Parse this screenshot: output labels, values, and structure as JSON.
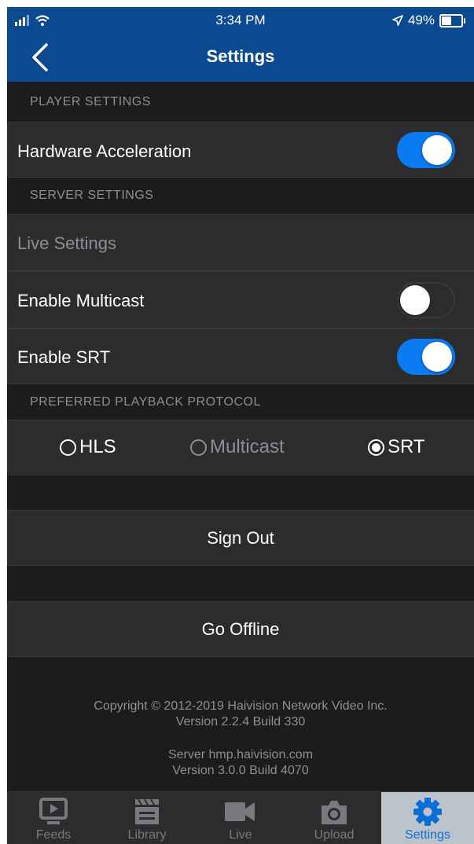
{
  "status_bar": {
    "time": "3:34 PM",
    "battery": "49%",
    "battery_level": 0.49
  },
  "header": {
    "title": "Settings"
  },
  "sections": {
    "player": "PLAYER SETTINGS",
    "server": "SERVER SETTINGS",
    "protocol": "PREFERRED PLAYBACK PROTOCOL"
  },
  "rows": {
    "hardware_acceleration": {
      "label": "Hardware Acceleration",
      "enabled": true
    },
    "live_settings": {
      "label": "Live Settings"
    },
    "enable_multicast": {
      "label": "Enable Multicast",
      "enabled": false
    },
    "enable_srt": {
      "label": "Enable SRT",
      "enabled": true
    }
  },
  "protocol_options": [
    {
      "label": "HLS",
      "selected": false,
      "enabled": true
    },
    {
      "label": "Multicast",
      "selected": false,
      "enabled": false
    },
    {
      "label": "SRT",
      "selected": true,
      "enabled": true
    }
  ],
  "actions": {
    "sign_out": "Sign Out",
    "go_offline": "Go Offline"
  },
  "footer": {
    "copyright": "Copyright © 2012-2019 Haivision Network Video Inc.",
    "version": "Version 2.2.4 Build 330",
    "server": "Server hmp.haivision.com",
    "server_version": "Version 3.0.0 Build 4070"
  },
  "tabs": [
    {
      "label": "Feeds",
      "icon": "feeds-icon",
      "active": false
    },
    {
      "label": "Library",
      "icon": "library-icon",
      "active": false
    },
    {
      "label": "Live",
      "icon": "camera-icon",
      "active": false
    },
    {
      "label": "Upload",
      "icon": "upload-icon",
      "active": false
    },
    {
      "label": "Settings",
      "icon": "gear-icon",
      "active": true
    }
  ],
  "colors": {
    "header": "#0b4a90",
    "accent": "#0a7bf0",
    "background": "#1c1c1e",
    "row": "#2c2c2e",
    "active_tab": "#bcc3cb"
  }
}
